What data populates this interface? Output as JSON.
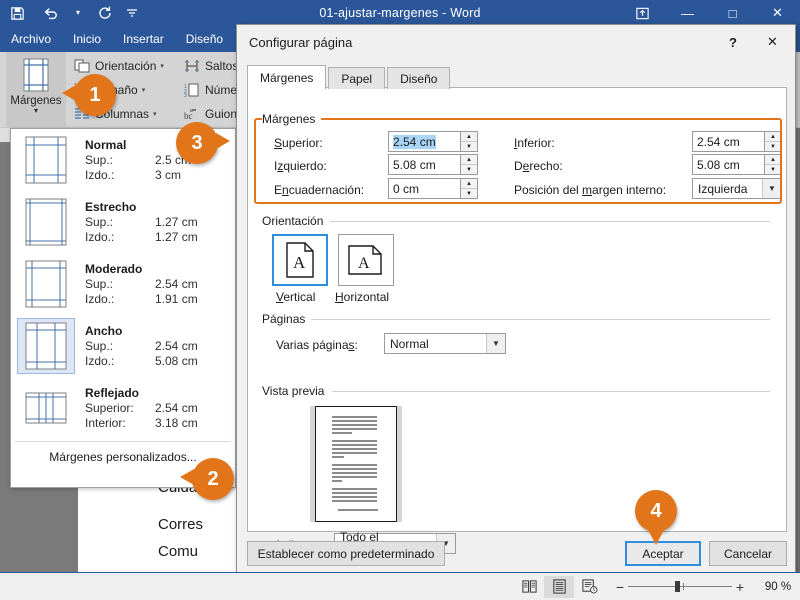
{
  "window": {
    "title": "01-ajustar-margenes  -  Word",
    "quick_access": [
      {
        "name": "save-icon",
        "glyph": "💾"
      },
      {
        "name": "undo-icon",
        "glyph": "↶"
      },
      {
        "name": "undo-dropdown-icon",
        "glyph": "▾"
      },
      {
        "name": "redo-icon",
        "glyph": "↻"
      },
      {
        "name": "customize-qat-icon",
        "glyph": "⨍"
      }
    ],
    "controls": {
      "ribbon_display": "⤒",
      "minimize": "—",
      "maximize": "□",
      "close": "✕"
    }
  },
  "ribbon": {
    "tabs": [
      "Archivo",
      "Inicio",
      "Insertar",
      "Diseño"
    ],
    "margins_group": {
      "label": "Márgenes",
      "caret": "▾"
    },
    "column_a": [
      {
        "label": "Orientación",
        "dropdown": "▾"
      },
      {
        "label": "Tamaño",
        "dropdown": "▾"
      },
      {
        "label": "Columnas",
        "dropdown": "▾"
      }
    ],
    "column_b": [
      {
        "label": "Saltos",
        "dropdown": "▾"
      },
      {
        "label": "Números",
        "dropdown": ""
      },
      {
        "label": "Guiones",
        "dropdown": "▾"
      }
    ]
  },
  "gallery": {
    "items": [
      {
        "name": "Normal",
        "rows": [
          {
            "k": "Sup.:",
            "v": "2.5 cm"
          },
          {
            "k": "Izdo.:",
            "v": "3 cm"
          }
        ],
        "selected": false
      },
      {
        "name": "Estrecho",
        "rows": [
          {
            "k": "Sup.:",
            "v": "1.27 cm"
          },
          {
            "k": "Izdo.:",
            "v": "1.27 cm"
          }
        ],
        "selected": false
      },
      {
        "name": "Moderado",
        "rows": [
          {
            "k": "Sup.:",
            "v": "2.54 cm"
          },
          {
            "k": "Izdo.:",
            "v": "1.91 cm"
          }
        ],
        "selected": false
      },
      {
        "name": "Ancho",
        "rows": [
          {
            "k": "Sup.:",
            "v": "2.54 cm"
          },
          {
            "k": "Izdo.:",
            "v": "5.08 cm"
          }
        ],
        "selected": true
      },
      {
        "name": "Reflejado",
        "rows": [
          {
            "k": "Superior:",
            "v": "2.54 cm"
          },
          {
            "k": "Interior:",
            "v": "3.18 cm"
          }
        ],
        "selected": false
      }
    ],
    "custom_label": "Márgenes personalizados..."
  },
  "document": {
    "lines": [
      "Cuida",
      "Corres",
      "Comu"
    ]
  },
  "dialog": {
    "title": "Configurar página",
    "help_glyph": "?",
    "close_glyph": "✕",
    "tabs": [
      {
        "label": "Márgenes",
        "active": true
      },
      {
        "label": "Papel",
        "active": false
      },
      {
        "label": "Diseño",
        "active": false
      }
    ],
    "margins": {
      "group_label": "Márgenes",
      "superior_label": "Superior:",
      "superior_value": "2.54 cm",
      "inferior_label": "Inferior:",
      "inferior_value": "2.54 cm",
      "izquierdo_label": "Izquierdo:",
      "izquierdo_value": "5.08 cm",
      "derecho_label": "Derecho:",
      "derecho_value": "5.08 cm",
      "encuadernacion_label": "Encuadernación:",
      "encuadernacion_value": "0 cm",
      "posicion_label": "Posición del margen interno:",
      "posicion_value": "Izquierda"
    },
    "orientation": {
      "group_label": "Orientación",
      "vertical_label": "Vertical",
      "horizontal_label": "Horizontal",
      "selected": "Vertical"
    },
    "pages": {
      "group_label": "Páginas",
      "varias_label": "Varias páginas:",
      "varias_value": "Normal"
    },
    "preview": {
      "group_label": "Vista previa",
      "aplicar_label": "Aplicar a:",
      "aplicar_value": "Todo el documento"
    },
    "footer": {
      "default_button": "Establecer como predeterminado",
      "ok_button": "Aceptar",
      "cancel_button": "Cancelar"
    }
  },
  "callouts": [
    {
      "number": "1"
    },
    {
      "number": "2"
    },
    {
      "number": "3"
    },
    {
      "number": "4"
    }
  ],
  "statusbar": {
    "views": [
      {
        "name": "read-mode-icon",
        "active": false
      },
      {
        "name": "print-layout-icon",
        "active": true
      },
      {
        "name": "web-layout-icon",
        "active": false
      }
    ],
    "zoom_out": "−",
    "zoom_in": "+",
    "zoom_level": "90 %"
  },
  "colors": {
    "word_blue": "#2b579a",
    "accent_orange": "#e2741a",
    "selection_blue": "#a8d4f5",
    "focus_blue": "#2f8fdd"
  }
}
